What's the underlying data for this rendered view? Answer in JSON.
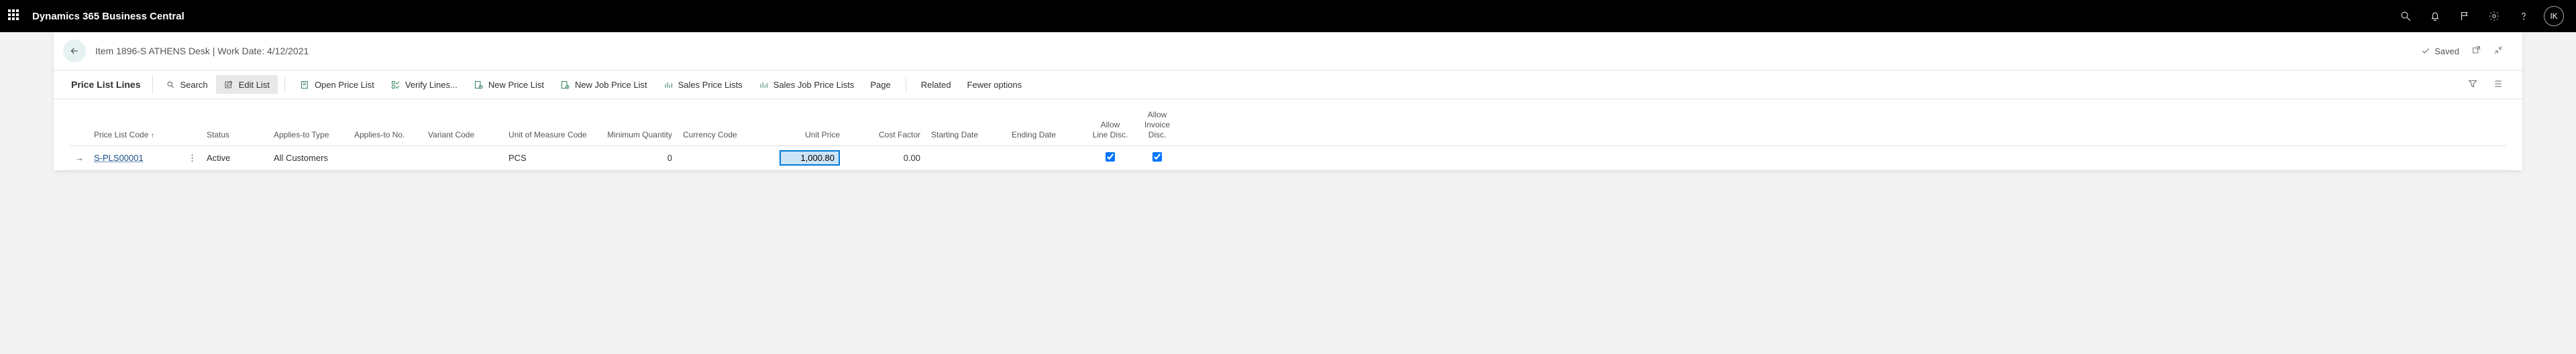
{
  "topbar": {
    "product": "Dynamics 365 Business Central",
    "avatar_initials": "IK"
  },
  "crumb": {
    "text": "Item 1896-S ATHENS Desk | Work Date: 4/12/2021",
    "saved_label": "Saved"
  },
  "toolbar": {
    "page_section": "Price List Lines",
    "search": "Search",
    "edit_list": "Edit List",
    "open_price_list": "Open Price List",
    "verify_lines": "Verify Lines...",
    "new_price_list": "New Price List",
    "new_job_price_list": "New Job Price List",
    "sales_price_lists": "Sales Price Lists",
    "sales_job_price_lists": "Sales Job Price Lists",
    "page": "Page",
    "related": "Related",
    "fewer_options": "Fewer options"
  },
  "grid": {
    "headers": {
      "price_list_code": "Price List Code",
      "status": "Status",
      "applies_to_type": "Applies-to Type",
      "applies_to_no": "Applies-to No.",
      "variant_code": "Variant Code",
      "uom": "Unit of Measure Code",
      "min_qty": "Minimum Quantity",
      "currency": "Currency Code",
      "unit_price": "Unit Price",
      "cost_factor": "Cost Factor",
      "starting_date": "Starting Date",
      "ending_date": "Ending Date",
      "allow_line_disc": "Allow Line Disc.",
      "allow_inv_disc": "Allow Invoice Disc."
    },
    "rows": [
      {
        "price_list_code": "S-PLS00001",
        "status": "Active",
        "applies_to_type": "All Customers",
        "applies_to_no": "",
        "variant_code": "",
        "uom": "PCS",
        "min_qty": "0",
        "currency": "",
        "unit_price": "1,000.80",
        "cost_factor": "0.00",
        "starting_date": "",
        "ending_date": "",
        "allow_line_disc": true,
        "allow_inv_disc": true
      }
    ]
  }
}
